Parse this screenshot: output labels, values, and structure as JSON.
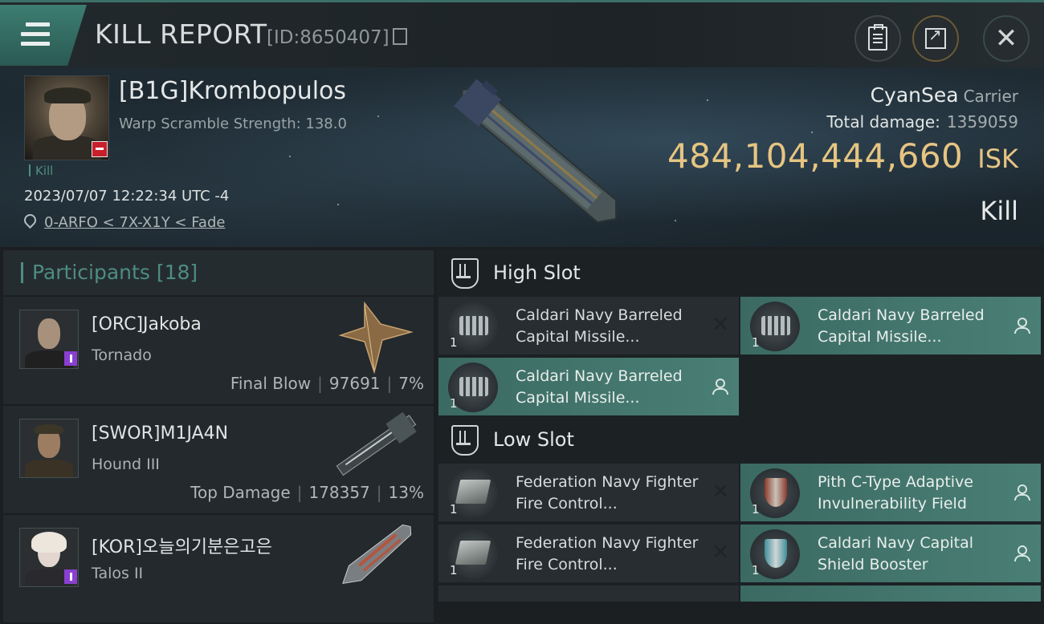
{
  "header": {
    "title": "KILL REPORT",
    "report_id": "[ID:8650407]"
  },
  "victim": {
    "name": "[B1G]Krombopulos",
    "warp_scramble": "Warp Scramble Strength: 138.0",
    "tag": "Kill",
    "timestamp": "2023/07/07 12:22:34 UTC -4",
    "location": "0-ARFO < 7X-X1Y < Fade",
    "ship_name": "CyanSea",
    "ship_class": "Carrier",
    "total_damage_label": "Total damage:",
    "total_damage": "1359059",
    "isk_value": "484,104,444,660",
    "isk_unit": "ISK",
    "outcome": "Kill"
  },
  "participants": {
    "label": "Participants",
    "count": "[18]",
    "items": [
      {
        "name": "[ORC]Jakoba",
        "ship": "Tornado",
        "role": "Final Blow",
        "damage": "97691",
        "percent": "7%"
      },
      {
        "name": "[SWOR]M1JA4N",
        "ship": "Hound III",
        "role": "Top Damage",
        "damage": "178357",
        "percent": "13%"
      },
      {
        "name": "[KOR]오늘의기분은고은",
        "ship": "Talos II",
        "role": "",
        "damage": "",
        "percent": ""
      }
    ]
  },
  "fitting": {
    "high_slot_label": "High Slot",
    "low_slot_label": "Low Slot",
    "high": [
      {
        "name": "Caldari Navy Barreled Capital Missile...",
        "qty": "1",
        "status": "destroyed"
      },
      {
        "name": "Caldari Navy Barreled Capital Missile...",
        "qty": "1",
        "status": "dropped"
      },
      {
        "name": "Caldari Navy Barreled Capital Missile...",
        "qty": "1",
        "status": "dropped"
      }
    ],
    "low": [
      {
        "name": "Federation Navy Fighter Fire Control...",
        "qty": "1",
        "status": "destroyed"
      },
      {
        "name": "Pith C-Type Adaptive Invulnerability Field",
        "qty": "1",
        "status": "dropped"
      },
      {
        "name": "Federation Navy Fighter Fire Control...",
        "qty": "1",
        "status": "destroyed"
      },
      {
        "name": "Caldari Navy Capital Shield Booster",
        "qty": "1",
        "status": "dropped"
      }
    ]
  },
  "colors": {
    "accent": "#4d8d7f",
    "isk": "#e6c582",
    "dropped_bg": "#4a7f75"
  }
}
